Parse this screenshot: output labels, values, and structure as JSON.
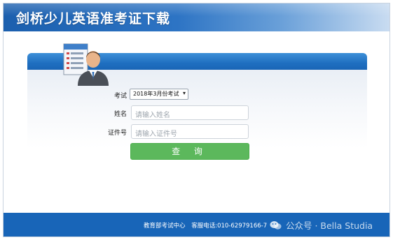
{
  "header": {
    "title": "剑桥少儿英语准考证下载"
  },
  "form": {
    "exam_label": "考试",
    "exam_selected": "2018年3月份考试",
    "name_label": "姓名",
    "name_placeholder": "请输入姓名",
    "id_label": "证件号",
    "id_placeholder": "请输入证件号",
    "query_button": "查 询"
  },
  "footer": {
    "center_text": "教育部考试中心",
    "phone_text": "客服电话:010-62979166-7",
    "watermark": "公众号 · Bella Studia"
  },
  "icons": {
    "avatar": "user-with-document-icon",
    "dropdown": "chevron-down-icon",
    "watermark": "wechat-icon"
  },
  "colors": {
    "banner_blue": "#1b5fae",
    "footer_blue": "#1865b8",
    "button_green": "#5cb85c"
  }
}
